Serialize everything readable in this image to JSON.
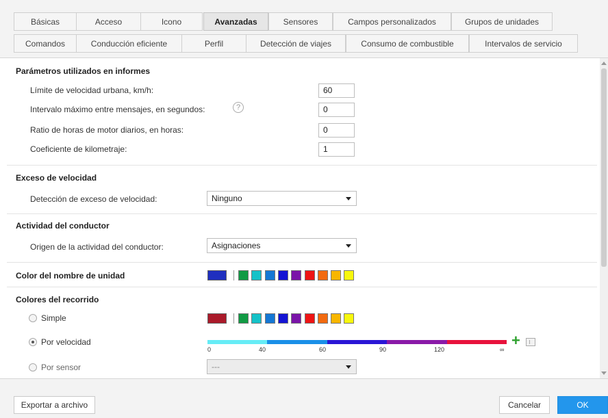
{
  "tabs_row1": [
    "Básicas",
    "Acceso",
    "Icono",
    "Avanzadas",
    "Sensores",
    "Campos personalizados",
    "Grupos de unidades"
  ],
  "tabs_row2": [
    "Comandos",
    "Conducción eficiente",
    "Perfil",
    "Detección de viajes",
    "Consumo de combustible",
    "Intervalos de servicio"
  ],
  "active_tab": "Avanzadas",
  "reports": {
    "title": "Parámetros utilizados en informes",
    "urban_speed_label": "Límite de velocidad urbana, km/h:",
    "urban_speed_value": "60",
    "max_interval_label": "Intervalo máximo entre mensajes, en segundos:",
    "max_interval_value": "0",
    "help_glyph": "?",
    "engine_hours_label": "Ratio de horas de motor diarios, en horas:",
    "engine_hours_value": "0",
    "mileage_coef_label": "Coeficiente de kilometraje:",
    "mileage_coef_value": "1"
  },
  "speeding": {
    "title": "Exceso de velocidad",
    "detection_label": "Detección de exceso de velocidad:",
    "detection_value": "Ninguno"
  },
  "driver": {
    "title": "Actividad del conductor",
    "origin_label": "Origen de la actividad del conductor:",
    "origin_value": "Asignaciones"
  },
  "unit_name_color": {
    "title": "Color del nombre de unidad",
    "current_color": "#1f2fbf"
  },
  "palette": [
    "#119a44",
    "#14c2c8",
    "#1577d4",
    "#1414d4",
    "#7a14a8",
    "#ee1414",
    "#f26a0f",
    "#f8b600",
    "#f7f70d"
  ],
  "track_colors": {
    "title": "Colores del recorrido",
    "simple_label": "Simple",
    "simple_color": "#aa1a2a",
    "by_speed_label": "Por velocidad",
    "by_sensor_label": "Por sensor",
    "sensor_value": "---",
    "selected": "by_speed",
    "speed_stops": [
      "0",
      "40",
      "60",
      "90",
      "120",
      "∞"
    ],
    "speed_segment_colors": [
      "#66ecf6",
      "#1a8fe8",
      "#2a16d6",
      "#8a1aa8",
      "#e8123c"
    ]
  },
  "footer": {
    "export_label": "Exportar a archivo",
    "cancel_label": "Cancelar",
    "ok_label": "OK"
  }
}
